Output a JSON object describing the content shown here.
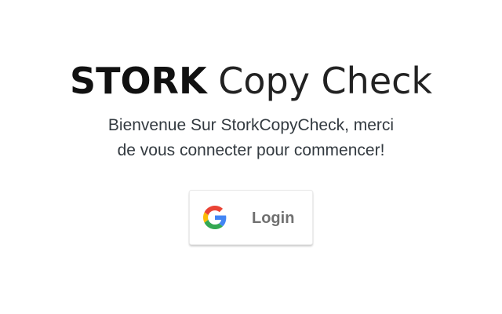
{
  "header": {
    "brand": "STORK",
    "title_rest": "Copy Check"
  },
  "welcome": {
    "line1": "Bienvenue Sur StorkCopyCheck, merci",
    "line2": "de vous connecter pour commencer!"
  },
  "login_button": {
    "label": "Login",
    "icon": "google-icon"
  },
  "colors": {
    "google_blue": "#4285F4",
    "google_red": "#EA4335",
    "google_yellow": "#FBBC05",
    "google_green": "#34A853"
  }
}
